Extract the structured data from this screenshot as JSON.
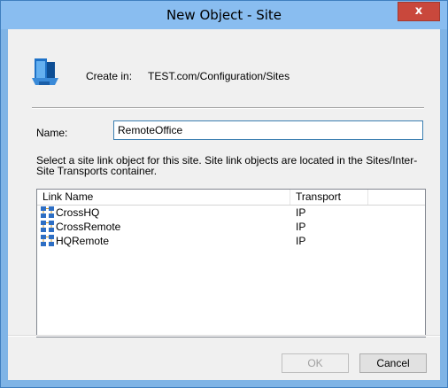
{
  "window": {
    "title": "New Object - Site",
    "close_label": "x"
  },
  "create_in": {
    "label": "Create in:",
    "path": "TEST.com/Configuration/Sites"
  },
  "name_field": {
    "label": "Name:",
    "value": "RemoteOffice"
  },
  "description": "Select a site link object for this site. Site link objects are located in the Sites/Inter-Site Transports container.",
  "table": {
    "columns": [
      "Link Name",
      "Transport"
    ],
    "rows": [
      {
        "link_name": "CrossHQ",
        "transport": "IP"
      },
      {
        "link_name": "CrossRemote",
        "transport": "IP"
      },
      {
        "link_name": "HQRemote",
        "transport": "IP"
      }
    ]
  },
  "buttons": {
    "ok": "OK",
    "cancel": "Cancel"
  },
  "colors": {
    "titlebar": "#89bdf0",
    "close": "#c9483c",
    "input_border": "#3c7fb1"
  }
}
